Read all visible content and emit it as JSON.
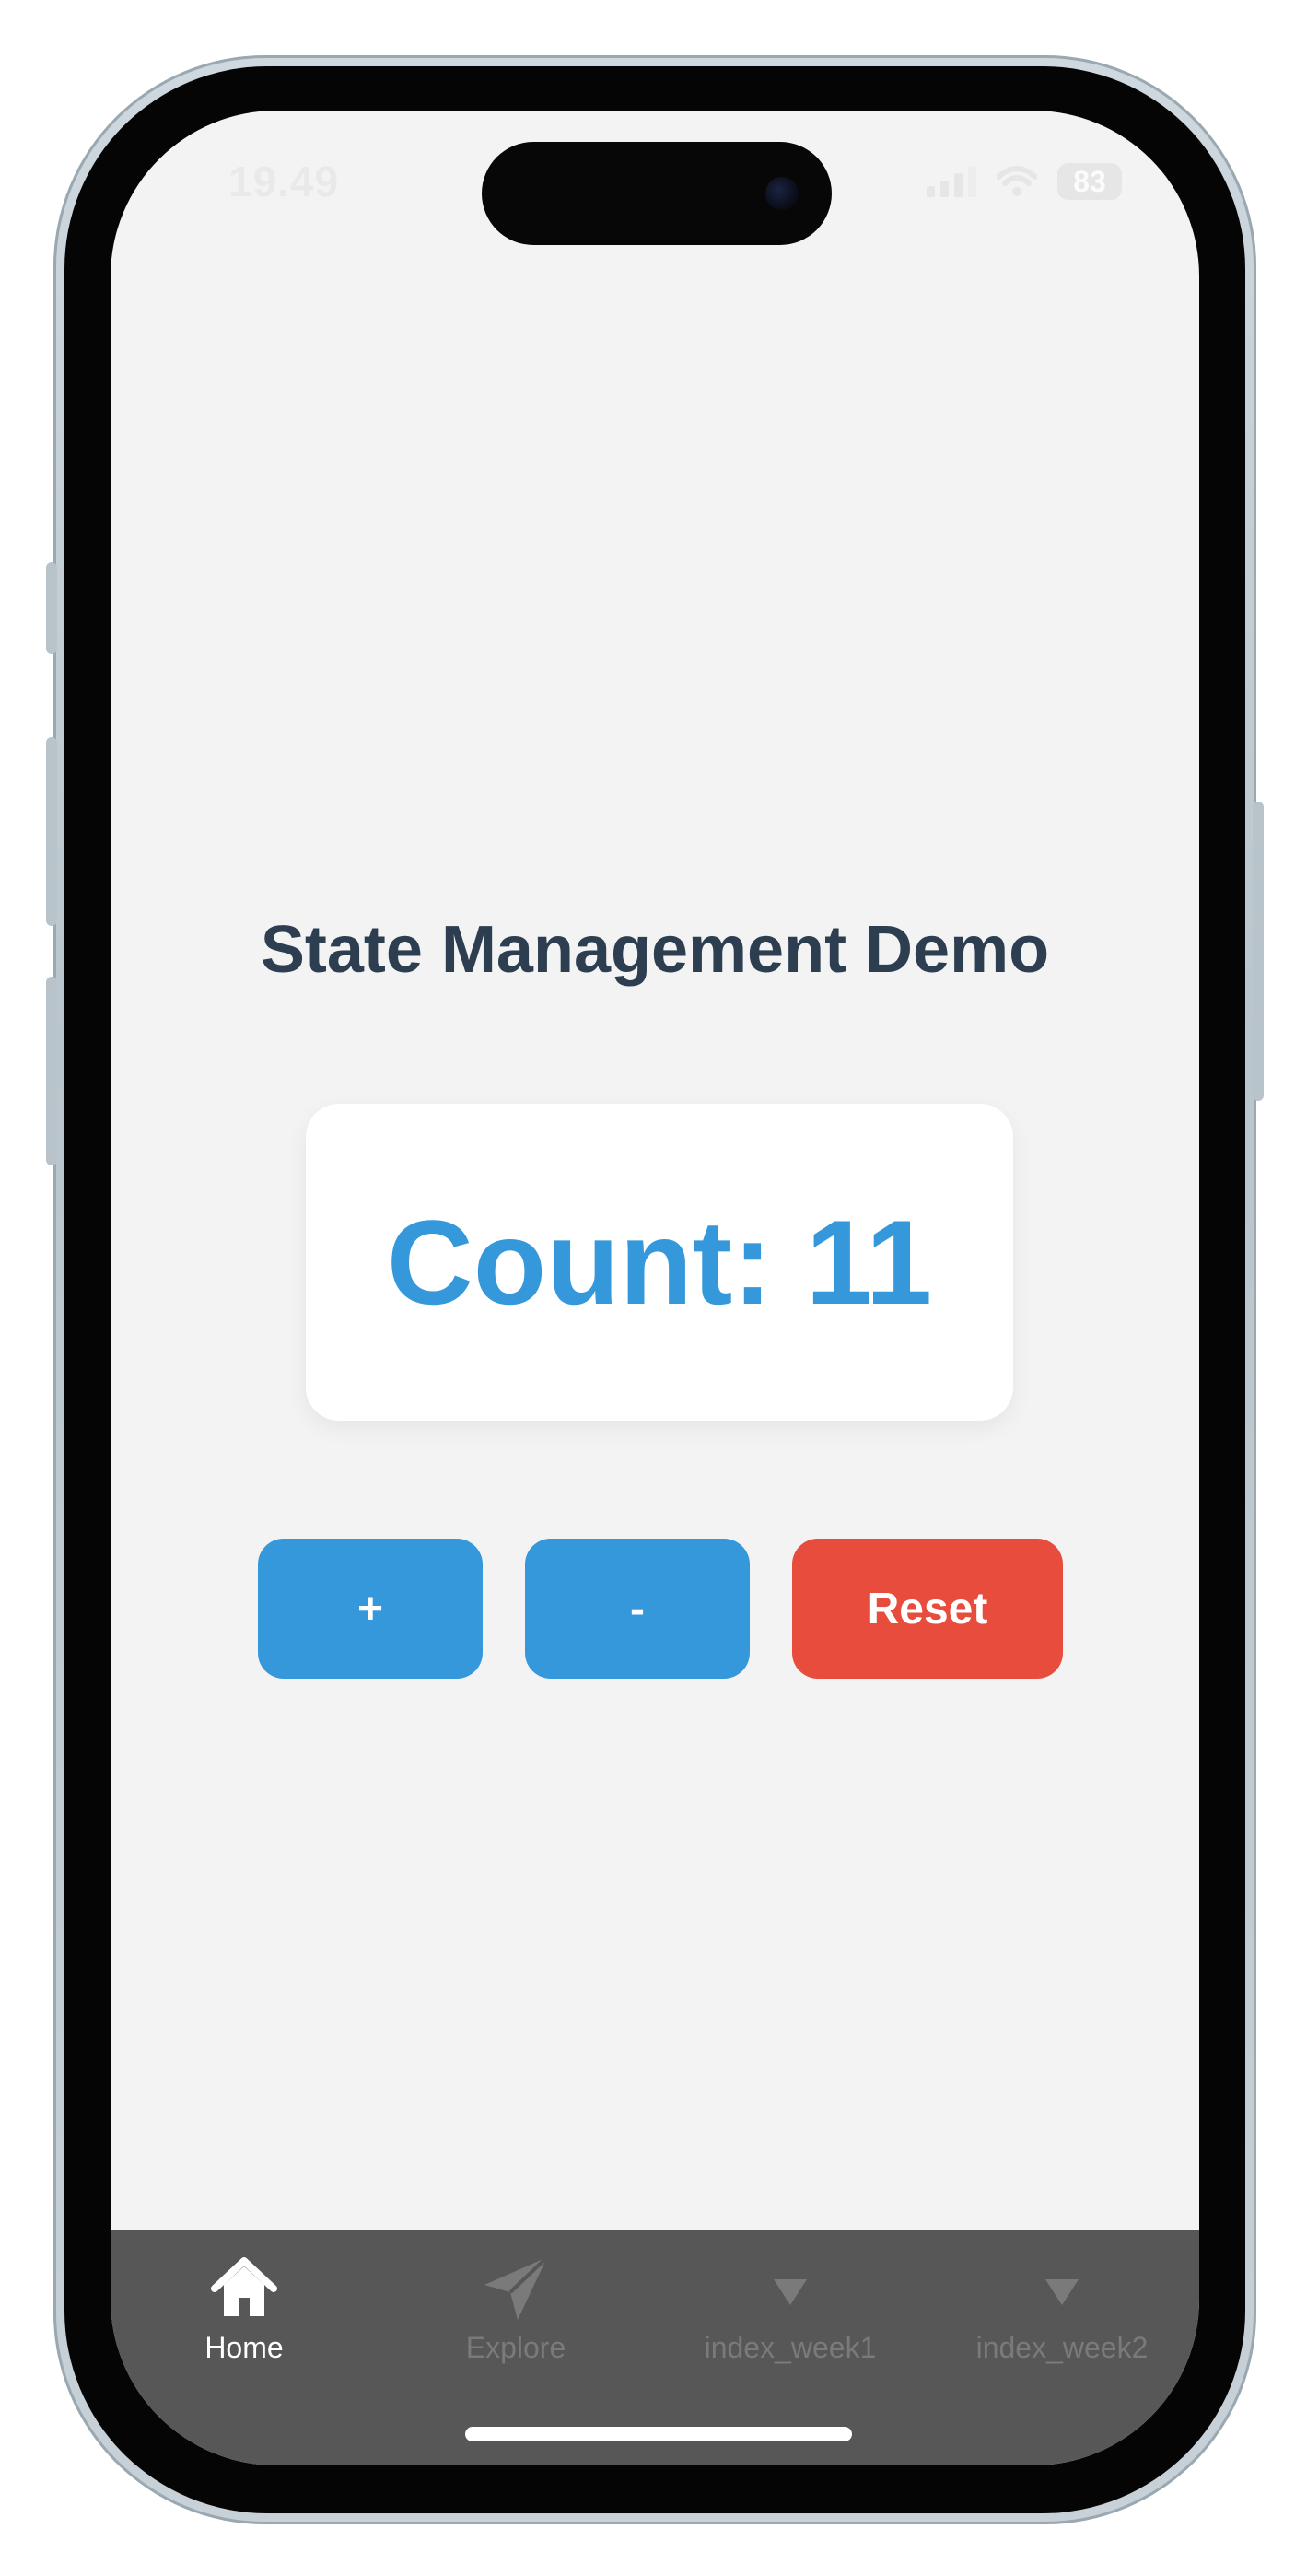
{
  "status_bar": {
    "time": "19.49",
    "battery": "83"
  },
  "main": {
    "title": "State Management Demo",
    "count_label": "Count: 11",
    "buttons": {
      "increment": "+",
      "decrement": "-",
      "reset": "Reset"
    }
  },
  "tabs": [
    {
      "label": "Home",
      "icon": "home-icon",
      "active": true
    },
    {
      "label": "Explore",
      "icon": "paper-plane-icon",
      "active": false
    },
    {
      "label": "index_week1",
      "icon": "triangle-down-icon",
      "active": false
    },
    {
      "label": "index_week2",
      "icon": "triangle-down-icon",
      "active": false
    }
  ],
  "colors": {
    "primary": "#3498db",
    "danger": "#e74c3c",
    "title": "#2c3e50",
    "screen_bg": "#f3f3f3",
    "tabbar_bg": "#575757",
    "tab_active": "#ffffff",
    "tab_inactive": "#7a7a7a"
  }
}
